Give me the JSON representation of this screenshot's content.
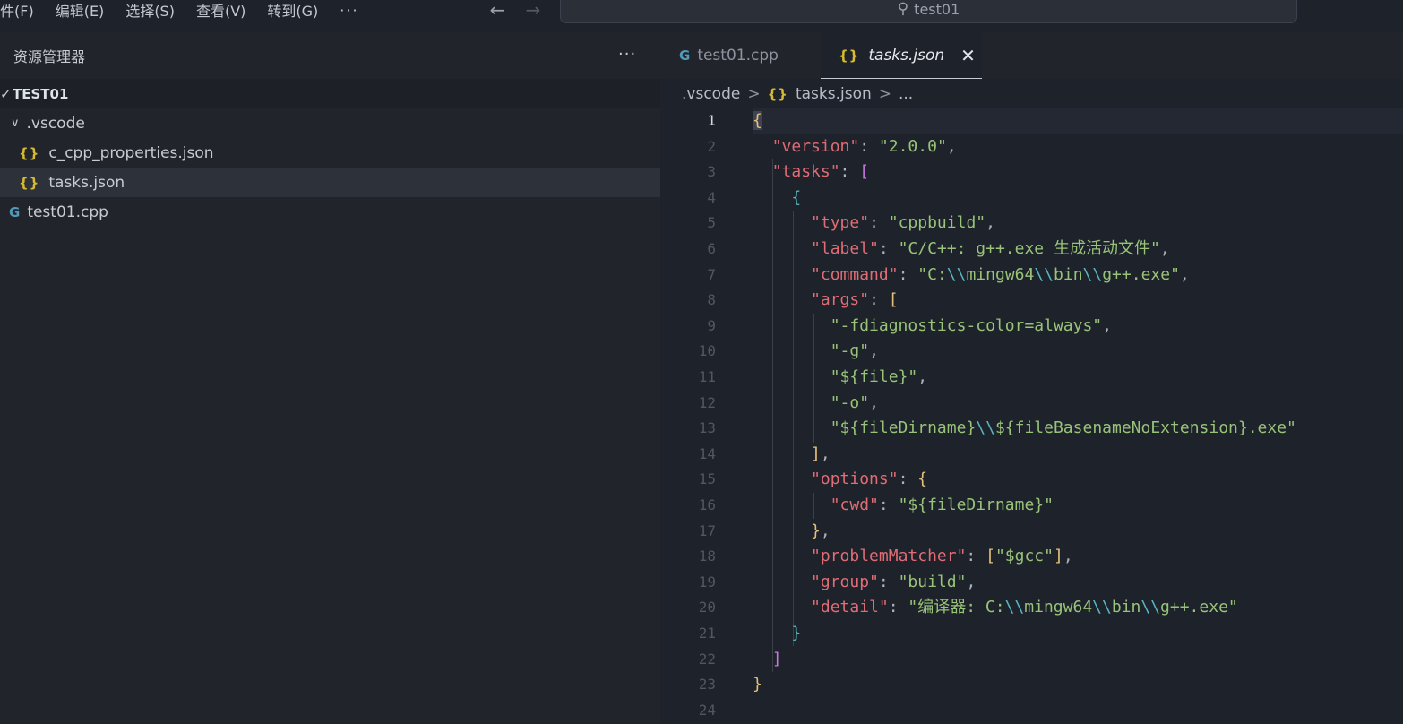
{
  "menu": {
    "items": [
      "件(F)",
      "编辑(E)",
      "选择(S)",
      "查看(V)",
      "转到(G)"
    ],
    "more": "···"
  },
  "nav": {
    "back_icon": "arrow-left-icon",
    "forward_icon": "arrow-right-icon"
  },
  "search": {
    "text": "test01",
    "icon": "search-icon"
  },
  "sidebar": {
    "title": "资源管理器",
    "more": "···",
    "root": "TEST01",
    "items": [
      {
        "label": ".vscode",
        "type": "folder"
      },
      {
        "label": "c_cpp_properties.json",
        "type": "json",
        "icon": "{}"
      },
      {
        "label": "tasks.json",
        "type": "json",
        "icon": "{}"
      },
      {
        "label": "test01.cpp",
        "type": "cpp",
        "icon": "C++"
      }
    ]
  },
  "tabs": [
    {
      "label": "test01.cpp",
      "icon": "cpp-icon",
      "active": false
    },
    {
      "label": "tasks.json",
      "icon": "json-icon",
      "active": true,
      "close": "✕"
    }
  ],
  "breadcrumb": {
    "folder": ".vscode",
    "file_icon": "{}",
    "file": "tasks.json",
    "sep": ">",
    "ellipsis": "..."
  },
  "editor": {
    "current_line": 1,
    "lines": [
      [
        [
          "b1",
          "{"
        ]
      ],
      [
        [
          "tk-p",
          "  "
        ],
        [
          "tk-key",
          "\"version\""
        ],
        [
          "tk-p",
          ": "
        ],
        [
          "tk-str",
          "\"2.0.0\""
        ],
        [
          "tk-p",
          ","
        ]
      ],
      [
        [
          "tk-p",
          "  "
        ],
        [
          "tk-key",
          "\"tasks\""
        ],
        [
          "tk-p",
          ": "
        ],
        [
          "b2",
          "["
        ]
      ],
      [
        [
          "tk-p",
          "    "
        ],
        [
          "b3",
          "{"
        ]
      ],
      [
        [
          "tk-p",
          "      "
        ],
        [
          "tk-key",
          "\"type\""
        ],
        [
          "tk-p",
          ": "
        ],
        [
          "tk-str",
          "\"cppbuild\""
        ],
        [
          "tk-p",
          ","
        ]
      ],
      [
        [
          "tk-p",
          "      "
        ],
        [
          "tk-key",
          "\"label\""
        ],
        [
          "tk-p",
          ": "
        ],
        [
          "tk-str",
          "\"C/C++: g++.exe 生成活动文件\""
        ],
        [
          "tk-p",
          ","
        ]
      ],
      [
        [
          "tk-p",
          "      "
        ],
        [
          "tk-key",
          "\"command\""
        ],
        [
          "tk-p",
          ": "
        ],
        [
          "tk-str",
          "\"C:"
        ],
        [
          "tk-esc",
          "\\\\"
        ],
        [
          "tk-str",
          "mingw64"
        ],
        [
          "tk-esc",
          "\\\\"
        ],
        [
          "tk-str",
          "bin"
        ],
        [
          "tk-esc",
          "\\\\"
        ],
        [
          "tk-str",
          "g++.exe\""
        ],
        [
          "tk-p",
          ","
        ]
      ],
      [
        [
          "tk-p",
          "      "
        ],
        [
          "tk-key",
          "\"args\""
        ],
        [
          "tk-p",
          ": "
        ],
        [
          "b4",
          "["
        ]
      ],
      [
        [
          "tk-p",
          "        "
        ],
        [
          "tk-str",
          "\"-fdiagnostics-color=always\""
        ],
        [
          "tk-p",
          ","
        ]
      ],
      [
        [
          "tk-p",
          "        "
        ],
        [
          "tk-str",
          "\"-g\""
        ],
        [
          "tk-p",
          ","
        ]
      ],
      [
        [
          "tk-p",
          "        "
        ],
        [
          "tk-str",
          "\"${file}\""
        ],
        [
          "tk-p",
          ","
        ]
      ],
      [
        [
          "tk-p",
          "        "
        ],
        [
          "tk-str",
          "\"-o\""
        ],
        [
          "tk-p",
          ","
        ]
      ],
      [
        [
          "tk-p",
          "        "
        ],
        [
          "tk-str",
          "\"${fileDirname}"
        ],
        [
          "tk-esc",
          "\\\\"
        ],
        [
          "tk-str",
          "${fileBasenameNoExtension}.exe\""
        ]
      ],
      [
        [
          "tk-p",
          "      "
        ],
        [
          "b4",
          "]"
        ],
        [
          "tk-p",
          ","
        ]
      ],
      [
        [
          "tk-p",
          "      "
        ],
        [
          "tk-key",
          "\"options\""
        ],
        [
          "tk-p",
          ": "
        ],
        [
          "b4",
          "{"
        ]
      ],
      [
        [
          "tk-p",
          "        "
        ],
        [
          "tk-key",
          "\"cwd\""
        ],
        [
          "tk-p",
          ": "
        ],
        [
          "tk-str",
          "\"${fileDirname}\""
        ]
      ],
      [
        [
          "tk-p",
          "      "
        ],
        [
          "b4",
          "}"
        ],
        [
          "tk-p",
          ","
        ]
      ],
      [
        [
          "tk-p",
          "      "
        ],
        [
          "tk-key",
          "\"problemMatcher\""
        ],
        [
          "tk-p",
          ": "
        ],
        [
          "b4",
          "["
        ],
        [
          "tk-str",
          "\"$gcc\""
        ],
        [
          "b4",
          "]"
        ],
        [
          "tk-p",
          ","
        ]
      ],
      [
        [
          "tk-p",
          "      "
        ],
        [
          "tk-key",
          "\"group\""
        ],
        [
          "tk-p",
          ": "
        ],
        [
          "tk-str",
          "\"build\""
        ],
        [
          "tk-p",
          ","
        ]
      ],
      [
        [
          "tk-p",
          "      "
        ],
        [
          "tk-key",
          "\"detail\""
        ],
        [
          "tk-p",
          ": "
        ],
        [
          "tk-str",
          "\"编译器: C:"
        ],
        [
          "tk-esc",
          "\\\\"
        ],
        [
          "tk-str",
          "mingw64"
        ],
        [
          "tk-esc",
          "\\\\"
        ],
        [
          "tk-str",
          "bin"
        ],
        [
          "tk-esc",
          "\\\\"
        ],
        [
          "tk-str",
          "g++.exe\""
        ]
      ],
      [
        [
          "tk-p",
          "    "
        ],
        [
          "b3",
          "}"
        ]
      ],
      [
        [
          "tk-p",
          "  "
        ],
        [
          "b2",
          "]"
        ]
      ],
      [
        [
          "b1",
          "}"
        ]
      ],
      []
    ]
  }
}
